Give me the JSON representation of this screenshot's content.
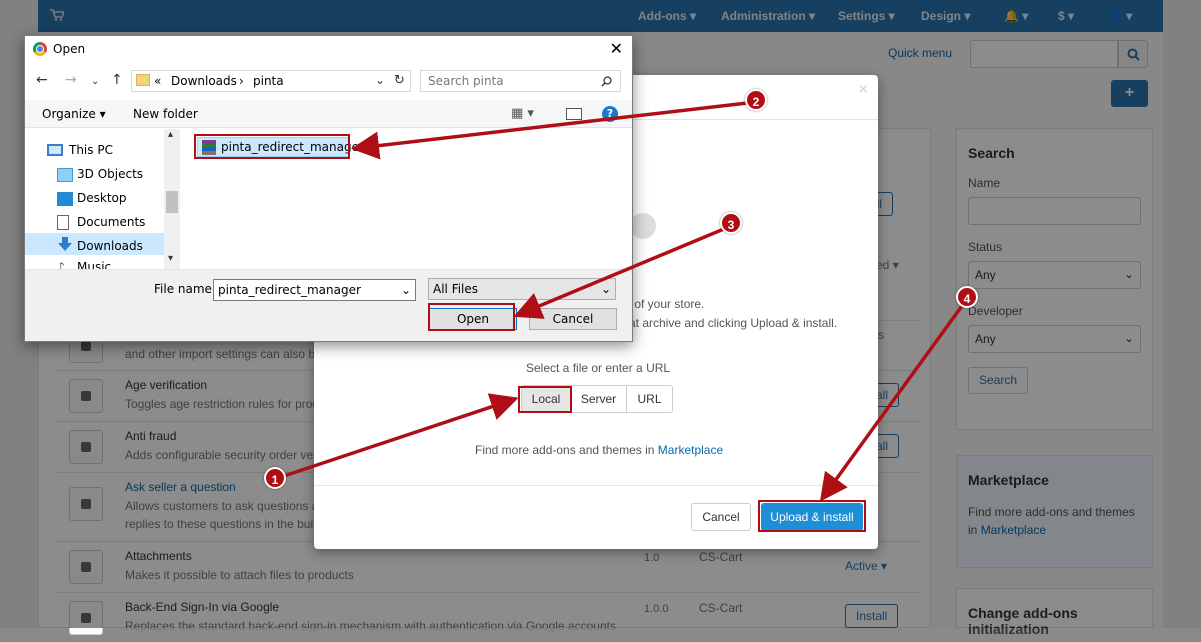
{
  "topnav": {
    "addons": "Add-ons",
    "administration": "Administration",
    "settings": "Settings",
    "design": "Design",
    "currency": "$"
  },
  "header": {
    "quick_menu": "Quick menu",
    "add_button": "+"
  },
  "addons_list": [
    {
      "desc": "and other import settings can also b"
    },
    {
      "title": "Age verification",
      "desc": "Toggles age restriction rules for prod"
    },
    {
      "title": "Anti fraud",
      "desc": "Adds configurable security order ver"
    },
    {
      "title": "Ask seller a question",
      "desc": "Allows customers to ask questions a",
      "desc2": "replies to these questions in the bui"
    },
    {
      "title": "Attachments",
      "desc": "Makes it possible to attach files to products",
      "version": "1.0",
      "developer": "CS-Cart",
      "status": "Active"
    },
    {
      "title": "Back-End Sign-In via Google",
      "desc": "Replaces the standard back-end sign-in mechanism with authentication via Google accounts",
      "version": "1.0.0",
      "developer": "CS-Cart",
      "action": "Install"
    }
  ],
  "row_actions": {
    "install_1": "all",
    "install_2": "all",
    "install_3": "all",
    "status_partial": "ed",
    "partial_1": "s",
    "install_full": "Install",
    "active": "Active"
  },
  "sidebar": {
    "search_title": "Search",
    "name_label": "Name",
    "status_label": "Status",
    "status_value": "Any",
    "developer_label": "Developer",
    "developer_value": "Any",
    "search_button": "Search",
    "marketplace_title": "Marketplace",
    "marketplace_text": "Find more add-ons and themes in",
    "marketplace_link": "Marketplace",
    "change_title": "Change add-ons",
    "change_title2": "initialization"
  },
  "modal": {
    "close": "×",
    "line1": "ity of your store.",
    "line2": "at archive and clicking Upload & install.",
    "select_label": "Select a file or enter a URL",
    "tabs": [
      "Local",
      "Server",
      "URL"
    ],
    "find_more": "Find more add-ons and themes in",
    "marketplace_link": "Marketplace",
    "cancel": "Cancel",
    "upload": "Upload & install"
  },
  "open_dialog": {
    "title": "Open",
    "close": "✕",
    "path": [
      "«",
      "Downloads",
      "pinta"
    ],
    "search_placeholder": "Search pinta",
    "organize": "Organize",
    "new_folder": "New folder",
    "tree": [
      "This PC",
      "3D Objects",
      "Desktop",
      "Documents",
      "Downloads",
      "Music"
    ],
    "file": "pinta_redirect_manager",
    "filename_label": "File name:",
    "filename_value": "pinta_redirect_manager",
    "filetype": "All Files",
    "open_btn": "Open",
    "cancel_btn": "Cancel"
  },
  "callouts": [
    "1",
    "2",
    "3",
    "4"
  ],
  "colors": {
    "topbar": "#2a73ad",
    "accent": "#1e8ed6",
    "annotation_red": "#b00e15"
  }
}
